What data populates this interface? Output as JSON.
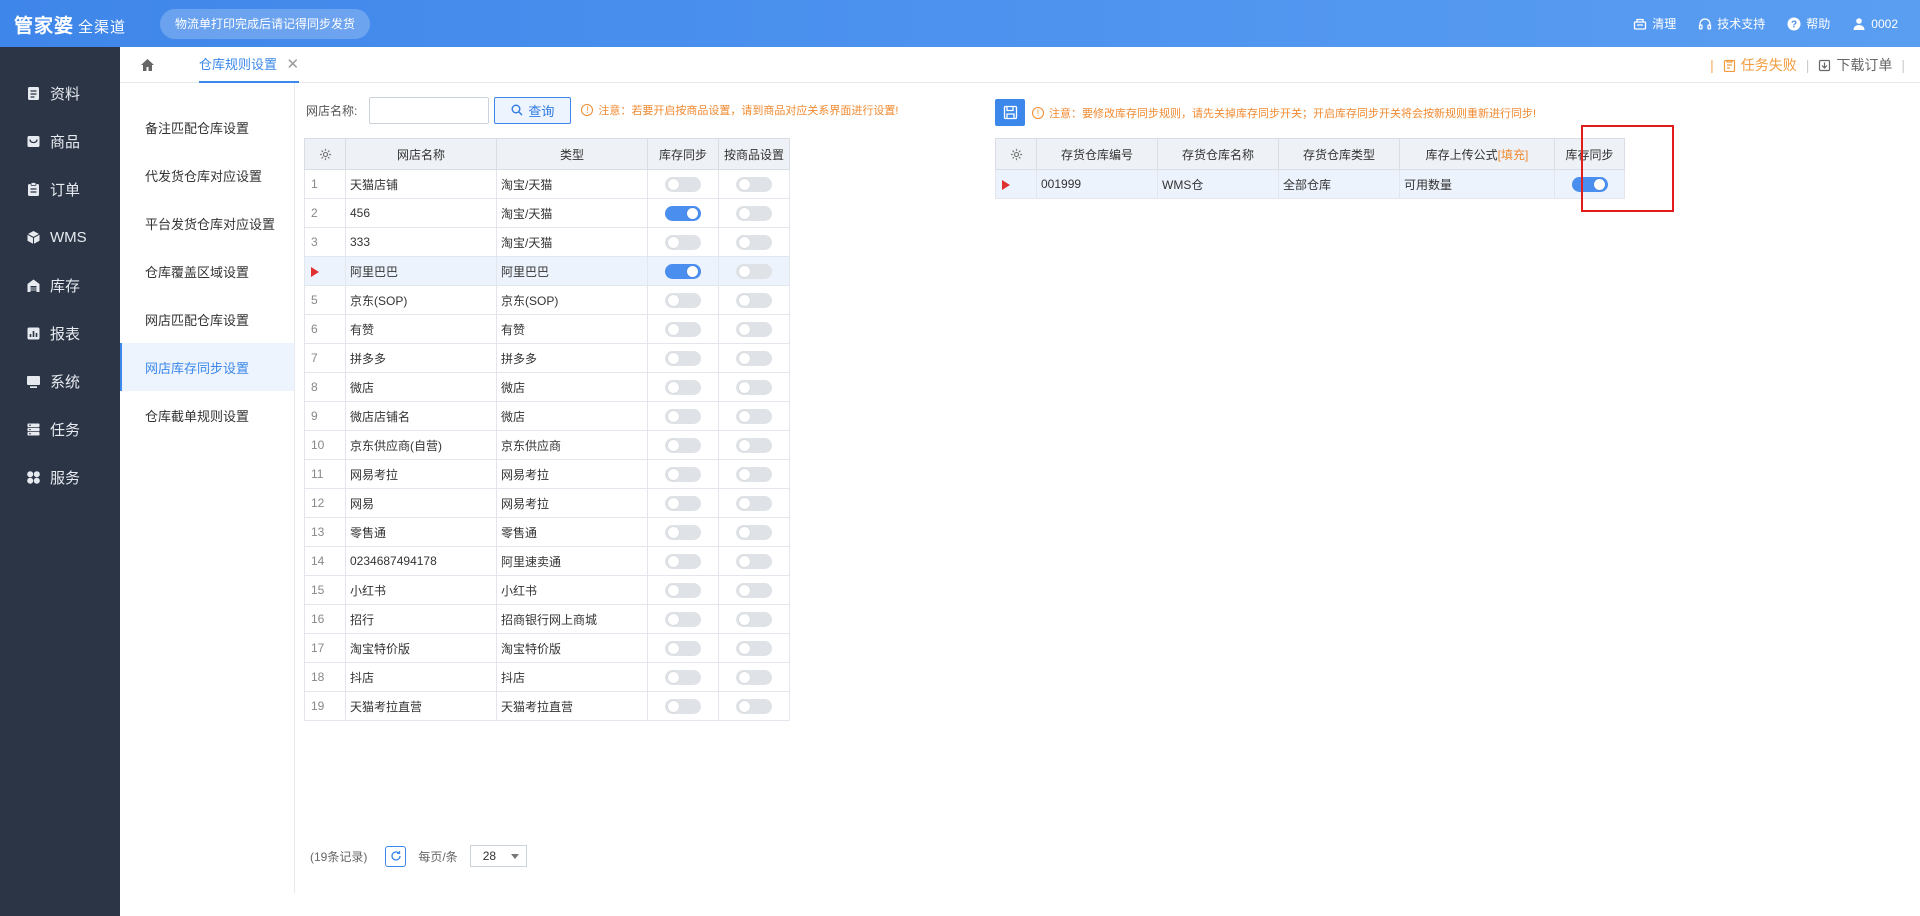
{
  "app": {
    "logo_text": "管家婆",
    "logo_sub": "全渠道",
    "notice": "物流单打印完成后请记得同步发货"
  },
  "top_actions": [
    {
      "label": "清理",
      "icon": "broom-icon"
    },
    {
      "label": "技术支持",
      "icon": "headset-icon"
    },
    {
      "label": "帮助",
      "icon": "help-icon"
    },
    {
      "label": "0002",
      "icon": "user-icon"
    }
  ],
  "sidebar": {
    "items": [
      {
        "label": "资料",
        "icon": "document-icon"
      },
      {
        "label": "商品",
        "icon": "goods-icon"
      },
      {
        "label": "订单",
        "icon": "order-icon"
      },
      {
        "label": "WMS",
        "icon": "cube-icon"
      },
      {
        "label": "库存",
        "icon": "inventory-icon"
      },
      {
        "label": "报表",
        "icon": "report-icon"
      },
      {
        "label": "系统",
        "icon": "monitor-icon"
      },
      {
        "label": "任务",
        "icon": "task-icon"
      },
      {
        "label": "服务",
        "icon": "service-icon"
      }
    ]
  },
  "tabs": {
    "home_icon": "home-icon",
    "active": "仓库规则设置",
    "close": "✕",
    "task_fail": "任务失败",
    "download": "下载订单"
  },
  "submenu": {
    "items": [
      "备注匹配仓库设置",
      "代发货仓库对应设置",
      "平台发货仓库对应设置",
      "仓库覆盖区域设置",
      "网店匹配仓库设置",
      "网店库存同步设置",
      "仓库截单规则设置"
    ],
    "active_index": 5
  },
  "filter": {
    "label": "网店名称:",
    "input_value": "",
    "query_label": "查询",
    "warning": "注意：若要开启按商品设置，请到商品对应关系界面进行设置!"
  },
  "left_table": {
    "headers": [
      "网店名称",
      "类型",
      "库存同步",
      "按商品设置"
    ],
    "rows": [
      {
        "no": "1",
        "name": "天猫店铺",
        "type": "淘宝/天猫",
        "sync": false,
        "by_goods": false
      },
      {
        "no": "2",
        "name": "456",
        "type": "淘宝/天猫",
        "sync": true,
        "by_goods": false
      },
      {
        "no": "3",
        "name": "333",
        "type": "淘宝/天猫",
        "sync": false,
        "by_goods": false
      },
      {
        "no": "",
        "name": "阿里巴巴",
        "type": "阿里巴巴",
        "sync": true,
        "by_goods": false,
        "selected": true
      },
      {
        "no": "5",
        "name": "京东(SOP)",
        "type": "京东(SOP)",
        "sync": false,
        "by_goods": false
      },
      {
        "no": "6",
        "name": "有赞",
        "type": "有赞",
        "sync": false,
        "by_goods": false
      },
      {
        "no": "7",
        "name": "拼多多",
        "type": "拼多多",
        "sync": false,
        "by_goods": false
      },
      {
        "no": "8",
        "name": "微店",
        "type": "微店",
        "sync": false,
        "by_goods": false
      },
      {
        "no": "9",
        "name": "微店店铺名",
        "type": "微店",
        "sync": false,
        "by_goods": false
      },
      {
        "no": "10",
        "name": "京东供应商(自营)",
        "type": "京东供应商",
        "sync": false,
        "by_goods": false
      },
      {
        "no": "11",
        "name": "网易考拉",
        "type": "网易考拉",
        "sync": false,
        "by_goods": false
      },
      {
        "no": "12",
        "name": "网易",
        "type": "网易考拉",
        "sync": false,
        "by_goods": false
      },
      {
        "no": "13",
        "name": "零售通",
        "type": "零售通",
        "sync": false,
        "by_goods": false
      },
      {
        "no": "14",
        "name": "0234687494178",
        "type": "阿里速卖通",
        "sync": false,
        "by_goods": false
      },
      {
        "no": "15",
        "name": "小红书",
        "type": "小红书",
        "sync": false,
        "by_goods": false
      },
      {
        "no": "16",
        "name": "招行",
        "type": "招商银行网上商城",
        "sync": false,
        "by_goods": false
      },
      {
        "no": "17",
        "name": "淘宝特价版",
        "type": "淘宝特价版",
        "sync": false,
        "by_goods": false
      },
      {
        "no": "18",
        "name": "抖店",
        "type": "抖店",
        "sync": false,
        "by_goods": false
      },
      {
        "no": "19",
        "name": "天猫考拉直营",
        "type": "天猫考拉直营",
        "sync": false,
        "by_goods": false
      }
    ]
  },
  "pager": {
    "records": "(19条记录)",
    "per_page_label": "每页/条",
    "page_size": "28"
  },
  "right_panel": {
    "warning": "注意：要修改库存同步规则，请先关掉库存同步开关；开启库存同步开关将会按新规则重新进行同步!",
    "headers": [
      "存货仓库编号",
      "存货仓库名称",
      "存货仓库类型",
      "库存上传公式",
      "库存同步"
    ],
    "formula_fill": "[填充]",
    "rows": [
      {
        "code": "001999",
        "name": "WMS仓",
        "type": "全部仓库",
        "formula": "可用数量",
        "sync": true
      }
    ]
  },
  "colors": {
    "primary": "#3c88ea",
    "sidebar_bg": "#2c3546",
    "warning": "#f08a31",
    "highlight": "#e21b1b"
  }
}
